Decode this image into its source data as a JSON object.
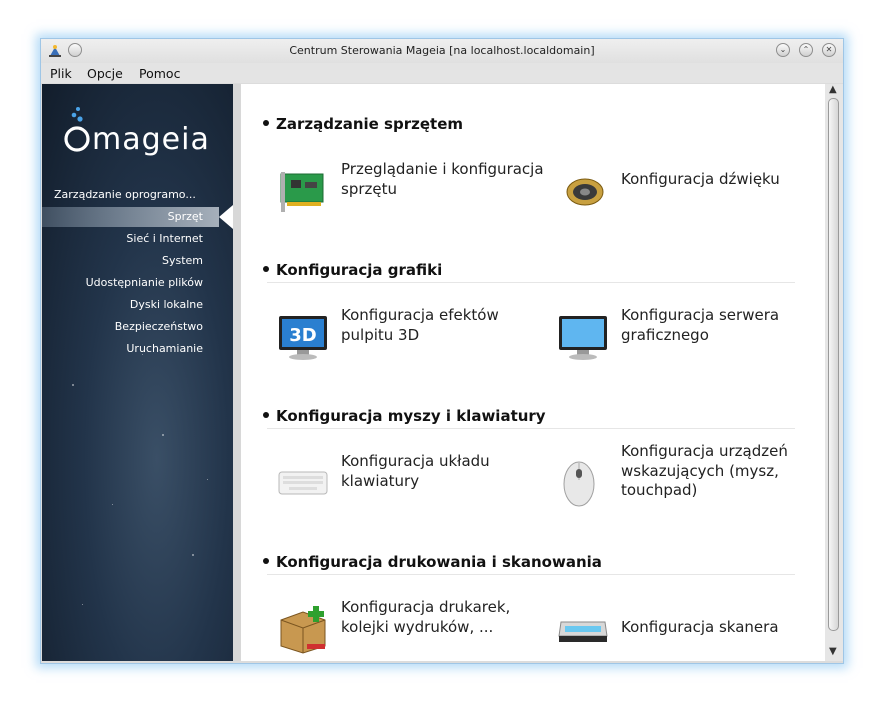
{
  "window": {
    "title": "Centrum Sterowania Mageia  [na localhost.localdomain]"
  },
  "menubar": {
    "items": [
      {
        "label": "Plik"
      },
      {
        "label": "Opcje"
      },
      {
        "label": "Pomoc"
      }
    ]
  },
  "sidebar": {
    "logo_text": "mageia",
    "items": [
      {
        "label": "Zarządzanie oprogramo..."
      },
      {
        "label": "Sprzęt",
        "selected": true
      },
      {
        "label": "Sieć i Internet"
      },
      {
        "label": "System"
      },
      {
        "label": "Udostępnianie plików"
      },
      {
        "label": "Dyski lokalne"
      },
      {
        "label": "Bezpieczeństwo"
      },
      {
        "label": "Uruchamianie"
      }
    ]
  },
  "sections": [
    {
      "title": "Zarządzanie sprzętem",
      "items": [
        {
          "label": "Przeglądanie i konfiguracja sprzętu",
          "icon": "pci-card-icon"
        },
        {
          "label": "Konfiguracja dźwięku",
          "icon": "speaker-icon"
        }
      ]
    },
    {
      "title": "Konfiguracja grafiki",
      "items": [
        {
          "label": "Konfiguracja efektów pulpitu 3D",
          "icon": "3d-monitor-icon",
          "icon_text": "3D"
        },
        {
          "label": "Konfiguracja serwera graficznego",
          "icon": "monitor-icon"
        }
      ]
    },
    {
      "title": "Konfiguracja myszy i klawiatury",
      "items": [
        {
          "label": "Konfiguracja układu klawiatury",
          "icon": "keyboard-icon"
        },
        {
          "label": "Konfiguracja urządzeń wskazujących (mysz, touchpad)",
          "icon": "mouse-icon"
        }
      ]
    },
    {
      "title": "Konfiguracja drukowania i skanowania",
      "items": [
        {
          "label": "Konfiguracja drukarek, kolejki wydruków, ...",
          "icon": "printer-package-icon"
        },
        {
          "label": "Konfiguracja skanera",
          "icon": "scanner-icon"
        }
      ]
    }
  ],
  "colors": {
    "sidebar_dark": "#121d2b",
    "sidebar_light": "#3a4f66",
    "selection": "#a6b0bb",
    "window_glow": "#78bef0"
  }
}
